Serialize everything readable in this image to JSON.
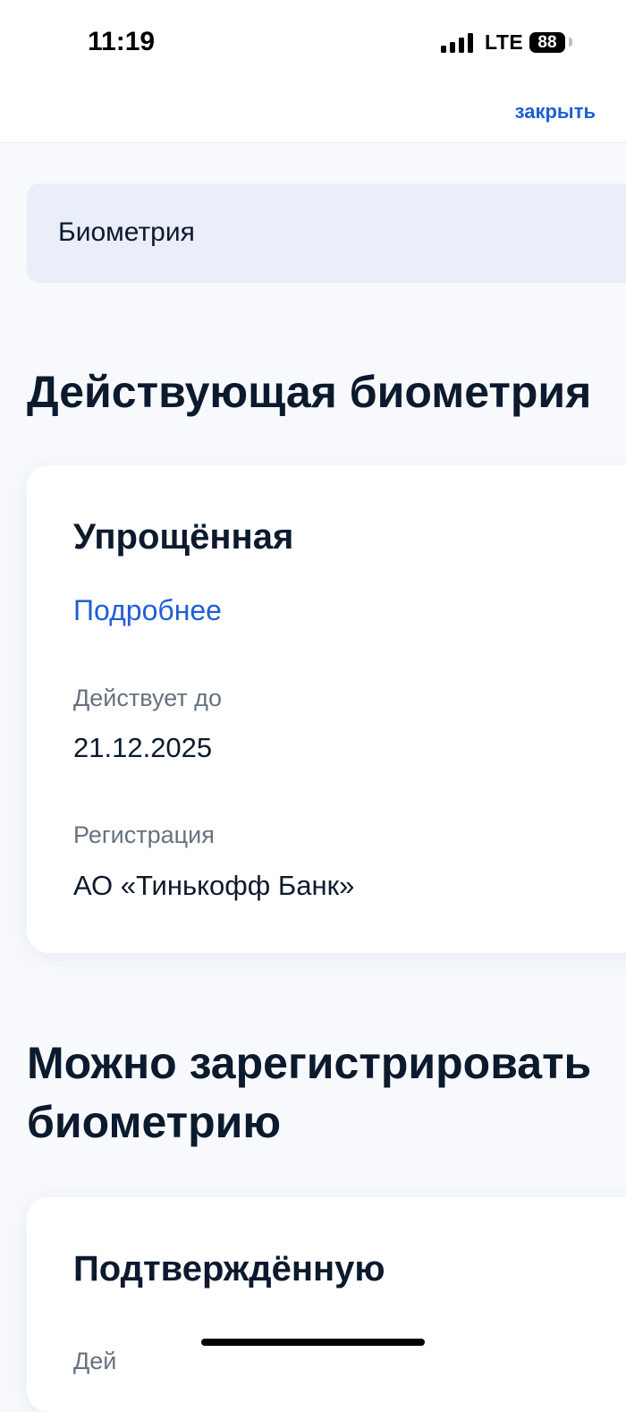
{
  "status_bar": {
    "time": "11:19",
    "network": "LTE",
    "battery": "88"
  },
  "header": {
    "close_label": "закрыть"
  },
  "breadcrumb": {
    "label": "Биометрия"
  },
  "current_section": {
    "title": "Действующая биометрия",
    "card": {
      "title": "Упрощённая",
      "details_link": "Подробнее",
      "valid_until_label": "Действует до",
      "valid_until_value": "21.12.2025",
      "registration_label": "Регистрация",
      "registration_value": "АО «Тинькофф Банк»"
    }
  },
  "register_section": {
    "title_line1": "Можно зарегистрировать",
    "title_line2": "биометрию",
    "card": {
      "title": "Подтверждённую",
      "partial_label": "Дей"
    }
  },
  "colors": {
    "accent": "#1f5fd6",
    "text_primary": "#0c1a2e",
    "text_secondary": "#66727f",
    "background": "#f7f9fd",
    "breadcrumb_bg": "#e9eef8"
  }
}
